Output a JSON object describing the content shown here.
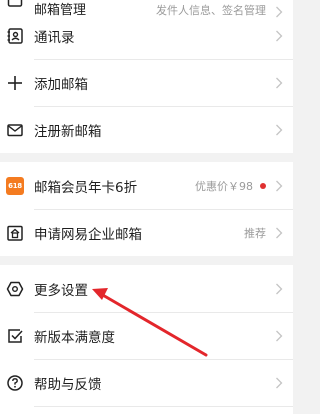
{
  "colors": {
    "annotation_arrow": "#e3262b",
    "dot": "#e03131",
    "badge": "#f47b20"
  },
  "top_partial": {
    "label": "邮箱管理",
    "hint": "发件人信息、签名管理",
    "icon": "mailbox-icon"
  },
  "group1": [
    {
      "label": "通讯录",
      "icon": "contacts-icon"
    },
    {
      "label": "添加邮箱",
      "icon": "plus-icon"
    },
    {
      "label": "注册新邮箱",
      "icon": "envelope-icon"
    }
  ],
  "group2": [
    {
      "label": "邮箱会员年卡6折",
      "hint": "优惠价￥98",
      "icon": "vip-badge-icon",
      "badge_text": "618",
      "has_dot": true
    },
    {
      "label": "申请网易企业邮箱",
      "hint": "推荐",
      "icon": "enterprise-icon"
    }
  ],
  "group3": [
    {
      "label": "更多设置",
      "icon": "gear-icon"
    },
    {
      "label": "新版本满意度",
      "icon": "checkbox-icon"
    },
    {
      "label": "帮助与反馈",
      "icon": "help-icon"
    }
  ]
}
